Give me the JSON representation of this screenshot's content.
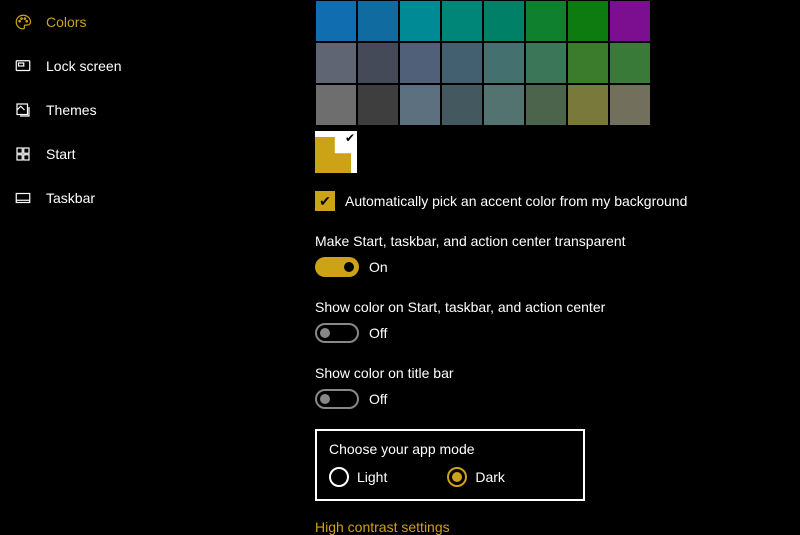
{
  "accent": "#cca216",
  "sidebar": {
    "items": [
      {
        "label": "Colors",
        "active": true
      },
      {
        "label": "Lock screen",
        "active": false
      },
      {
        "label": "Themes",
        "active": false
      },
      {
        "label": "Start",
        "active": false
      },
      {
        "label": "Taskbar",
        "active": false
      }
    ]
  },
  "swatches": {
    "rows": [
      [
        "#0f6db0",
        "#0f6ba0",
        "#008a95",
        "#008679",
        "#008167",
        "#0f812e",
        "#0e7b10",
        "#7c0f8f"
      ],
      [
        "#606573",
        "#444a58",
        "#4f6078",
        "#436071",
        "#457070",
        "#3b7659",
        "#3a7c2c",
        "#3a7a38"
      ],
      [
        "#6e6e6e",
        "#3e3e3e",
        "#5d7080",
        "#445860",
        "#537370",
        "#4d644c",
        "#79793b",
        "#72705d"
      ]
    ],
    "selected": "#cca216"
  },
  "autoAccent": {
    "checked": true,
    "label": "Automatically pick an accent color from my background"
  },
  "transparency": {
    "label": "Make Start, taskbar, and action center transparent",
    "on": true,
    "onText": "On"
  },
  "showColorStart": {
    "label": "Show color on Start, taskbar, and action center",
    "on": false,
    "offText": "Off"
  },
  "showColorTitle": {
    "label": "Show color on title bar",
    "on": false,
    "offText": "Off"
  },
  "appMode": {
    "label": "Choose your app mode",
    "options": {
      "light": "Light",
      "dark": "Dark"
    },
    "selected": "dark"
  },
  "highContrastLink": "High contrast settings"
}
